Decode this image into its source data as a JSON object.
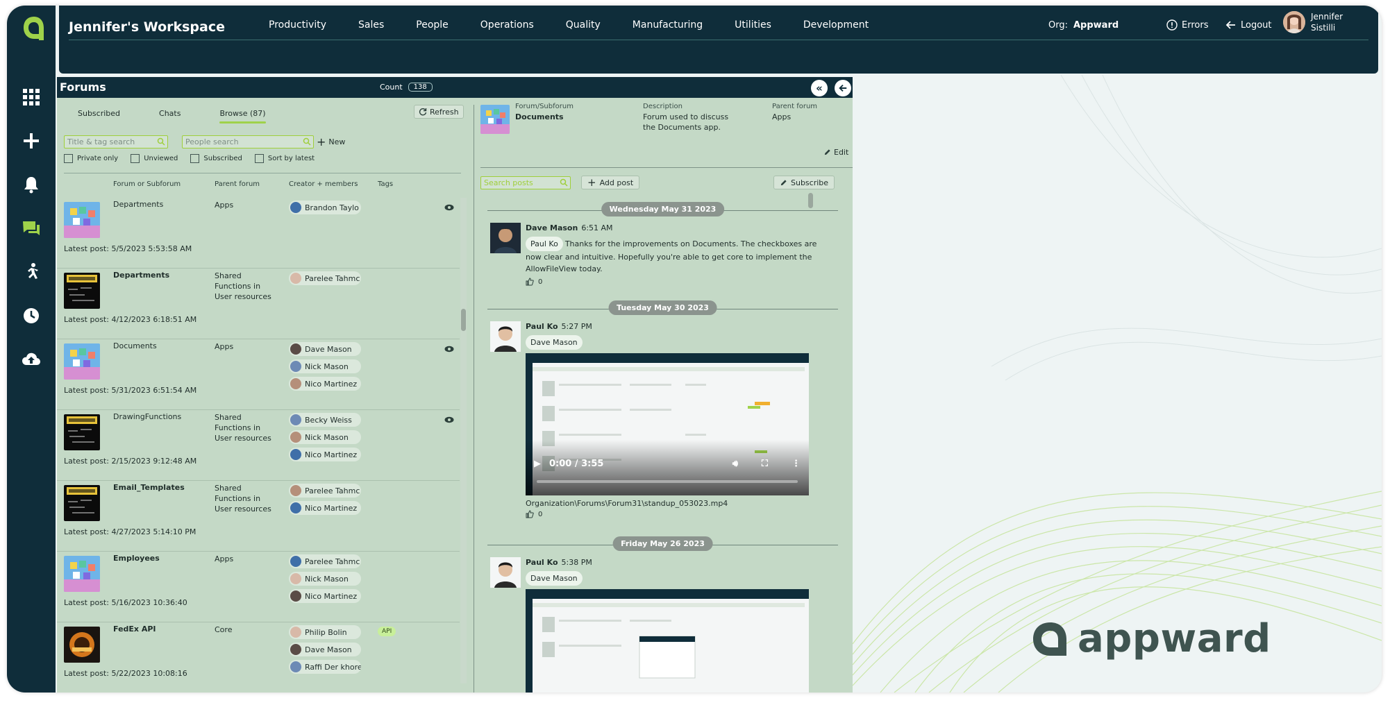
{
  "app": {
    "workspace_title": "Jennifer's Workspace",
    "nav": [
      "Productivity",
      "Sales",
      "People",
      "Operations",
      "Quality",
      "Manufacturing",
      "Utilities",
      "Development"
    ],
    "org_label": "Org:",
    "org_value": "Appward",
    "errors_label": "Errors",
    "logout_label": "Logout",
    "user_first": "Jennifer",
    "user_last": "Sistilli",
    "brand_text": "appward",
    "accent_color": "#9fd24a",
    "dark_color": "#0f2d3a"
  },
  "rail": {
    "icons": [
      "apps-grid-icon",
      "plus-icon",
      "bell-icon",
      "chat-icon",
      "runner-icon",
      "clock-icon",
      "cloud-upload-icon"
    ]
  },
  "forums": {
    "title": "Forums",
    "count_label": "Count",
    "count_value": "138",
    "tabs": [
      "Subscribed",
      "Chats",
      "Browse (87)"
    ],
    "active_tab": "Browse (87)",
    "refresh_label": "Refresh",
    "title_search_placeholder": "Title & tag search",
    "people_search_placeholder": "People search",
    "new_label": "New",
    "filters": [
      "Private only",
      "Unviewed",
      "Subscribed",
      "Sort by latest"
    ],
    "columns": [
      "Forum or Subforum",
      "Parent forum",
      "Creator + members",
      "Tags"
    ],
    "rows": [
      {
        "name": "Departments",
        "bold": false,
        "thumb": "apps",
        "parent": "Apps",
        "members": [
          "Brandon Taylo"
        ],
        "tags": [],
        "latest": "Latest post: 5/5/2023 5:53:58 AM",
        "eye": true
      },
      {
        "name": "Departments",
        "bold": true,
        "thumb": "functions",
        "parent": "Shared Functions in User resources",
        "members": [
          "Parelee Tahmc"
        ],
        "tags": [],
        "latest": "Latest post: 4/12/2023 6:18:51 AM",
        "eye": false
      },
      {
        "name": "Documents",
        "bold": false,
        "thumb": "apps",
        "parent": "Apps",
        "members": [
          "Dave Mason",
          "Nick Mason",
          "Nico Martinez"
        ],
        "tags": [],
        "latest": "Latest post: 5/31/2023 6:51:54 AM",
        "eye": true
      },
      {
        "name": "DrawingFunctions",
        "bold": false,
        "thumb": "functions",
        "parent": "Shared Functions in User resources",
        "members": [
          "Becky Weiss",
          "Nick Mason",
          "Nico Martinez"
        ],
        "tags": [],
        "latest": "Latest post: 2/15/2023 9:12:48 AM",
        "eye": true
      },
      {
        "name": "Email_Templates",
        "bold": true,
        "thumb": "functions",
        "parent": "Shared Functions in User resources",
        "members": [
          "Parelee Tahmc",
          "Nico Martinez"
        ],
        "tags": [],
        "latest": "Latest post: 4/27/2023 5:14:10 PM",
        "eye": false
      },
      {
        "name": "Employees",
        "bold": true,
        "thumb": "apps",
        "parent": "Apps",
        "members": [
          "Parelee Tahmc",
          "Nick Mason",
          "Nico Martinez"
        ],
        "tags": [],
        "latest": "Latest post: 5/16/2023 10:36:40",
        "eye": false
      },
      {
        "name": "FedEx API",
        "bold": true,
        "thumb": "core",
        "parent": "Core",
        "members": [
          "Philip Bolin",
          "Dave Mason",
          "Raffi Der khore"
        ],
        "tags": [
          "API"
        ],
        "latest": "Latest post: 5/22/2023 10:08:16",
        "eye": false
      }
    ]
  },
  "detail": {
    "forum_label": "Forum/Subforum",
    "forum_value": "Documents",
    "description_label": "Description",
    "description_value": "Forum used to discuss the Documents app.",
    "parent_label": "Parent forum",
    "parent_value": "Apps",
    "edit_label": "Edit",
    "search_placeholder": "Search posts",
    "add_post_label": "Add post",
    "subscribe_label": "Subscribe",
    "dates": [
      "Wednesday May 31 2023",
      "Tuesday May 30 2023",
      "Friday May 26 2023"
    ],
    "posts": [
      {
        "author": "Dave Mason",
        "time": "6:51 AM",
        "mention": "Paul Ko",
        "text": "Thanks for the improvements on Documents. The checkboxes are now clear and intuitive.  Hopefully you're able to get core to implement the AllowFileView today.",
        "likes": "0"
      },
      {
        "author": "Paul Ko",
        "time": "5:27 PM",
        "mention": "Dave Mason",
        "video_time": "0:00 / 3:55",
        "video_path": "Organization\\Forums\\Forum31\\standup_053023.mp4",
        "likes": "0"
      },
      {
        "author": "Paul Ko",
        "time": "5:38 PM",
        "mention": "Dave Mason"
      }
    ]
  }
}
